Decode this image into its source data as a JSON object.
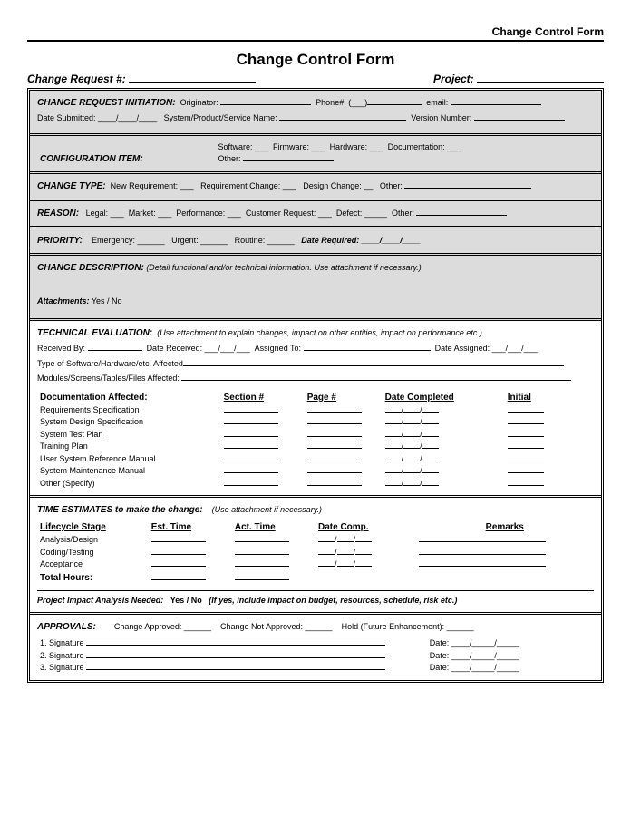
{
  "header": "Change Control Form",
  "title": "Change Control Form",
  "top": {
    "req": "Change Request #:",
    "proj": "Project:"
  },
  "s1": {
    "h": "CHANGE REQUEST INITIATION:",
    "orig": "Originator:",
    "phone": "Phone#: (___)",
    "email": "email:",
    "date": "Date Submitted: ____/____/____",
    "sys": "System/Product/Service Name:",
    "ver": "Version Number:"
  },
  "s2": {
    "h": "CONFIGURATION ITEM:",
    "sw": "Software: ___",
    "fw": "Firmware: ___",
    "hw": "Hardware: ___",
    "doc": "Documentation: ___",
    "oth": "Other:"
  },
  "s3": {
    "h": "CHANGE TYPE:",
    "nr": "New Requirement: ___",
    "rc": "Requirement Change: ___",
    "dc": "Design Change: __",
    "oth": "Other:"
  },
  "s4": {
    "h": "REASON:",
    "lg": "Legal: ___",
    "mk": "Market: ___",
    "pf": "Performance: ___",
    "cr": "Customer Request: ___",
    "df": "Defect: _____",
    "oth": "Other:"
  },
  "s5": {
    "h": "PRIORITY:",
    "em": "Emergency: ______",
    "ur": "Urgent: ______",
    "rt": "Routine: ______",
    "dr": "Date Required: ____/____/____"
  },
  "s6": {
    "h": "CHANGE DESCRIPTION:",
    "note": "(Detail functional and/or technical information. Use attachment if necessary.)",
    "att": "Attachments:",
    "yn": "Yes / No"
  },
  "s7": {
    "h": "TECHNICAL EVALUATION:",
    "note": "(Use attachment to explain changes, impact on other entities, impact on performance etc.)",
    "rb": "Received By:",
    "drc": "Date Received: ___/___/___",
    "at": "Assigned To:",
    "da": "Date Assigned: ___/___/___",
    "tsw": "Type of Software/Hardware/etc. Affected",
    "mod": "Modules/Screens/Tables/Files Affected:",
    "dah": "Documentation Affected:",
    "c1": "Section #",
    "c2": "Page #",
    "c3": "Date Completed",
    "c4": "Initial",
    "docs": [
      "Requirements Specification",
      "System Design Specification",
      "System Test Plan",
      "Training Plan",
      "User System Reference Manual",
      "System Maintenance Manual",
      "Other (Specify)"
    ]
  },
  "s8": {
    "h": "TIME ESTIMATES to make the change:",
    "note": "(Use attachment if necessary.)",
    "c1": "Lifecycle Stage",
    "c2": "Est. Time",
    "c3": "Act. Time",
    "c4": "Date Comp.",
    "c5": "Remarks",
    "rows": [
      "Analysis/Design",
      "Coding/Testing",
      "Acceptance"
    ],
    "tot": "Total Hours:",
    "pia": "Project Impact Analysis Needed:",
    "yn": "Yes / No",
    "pian": "(If yes, include impact on budget, resources, schedule, risk etc.)"
  },
  "s9": {
    "h": "APPROVALS:",
    "ca": "Change Approved: ______",
    "cna": "Change Not Approved: ______",
    "hold": "Hold (Future Enhancement): ______",
    "s1": "1. Signature",
    "s2": "2. Signature",
    "s3": "3. Signature",
    "dt": "Date: ____/_____/_____"
  }
}
